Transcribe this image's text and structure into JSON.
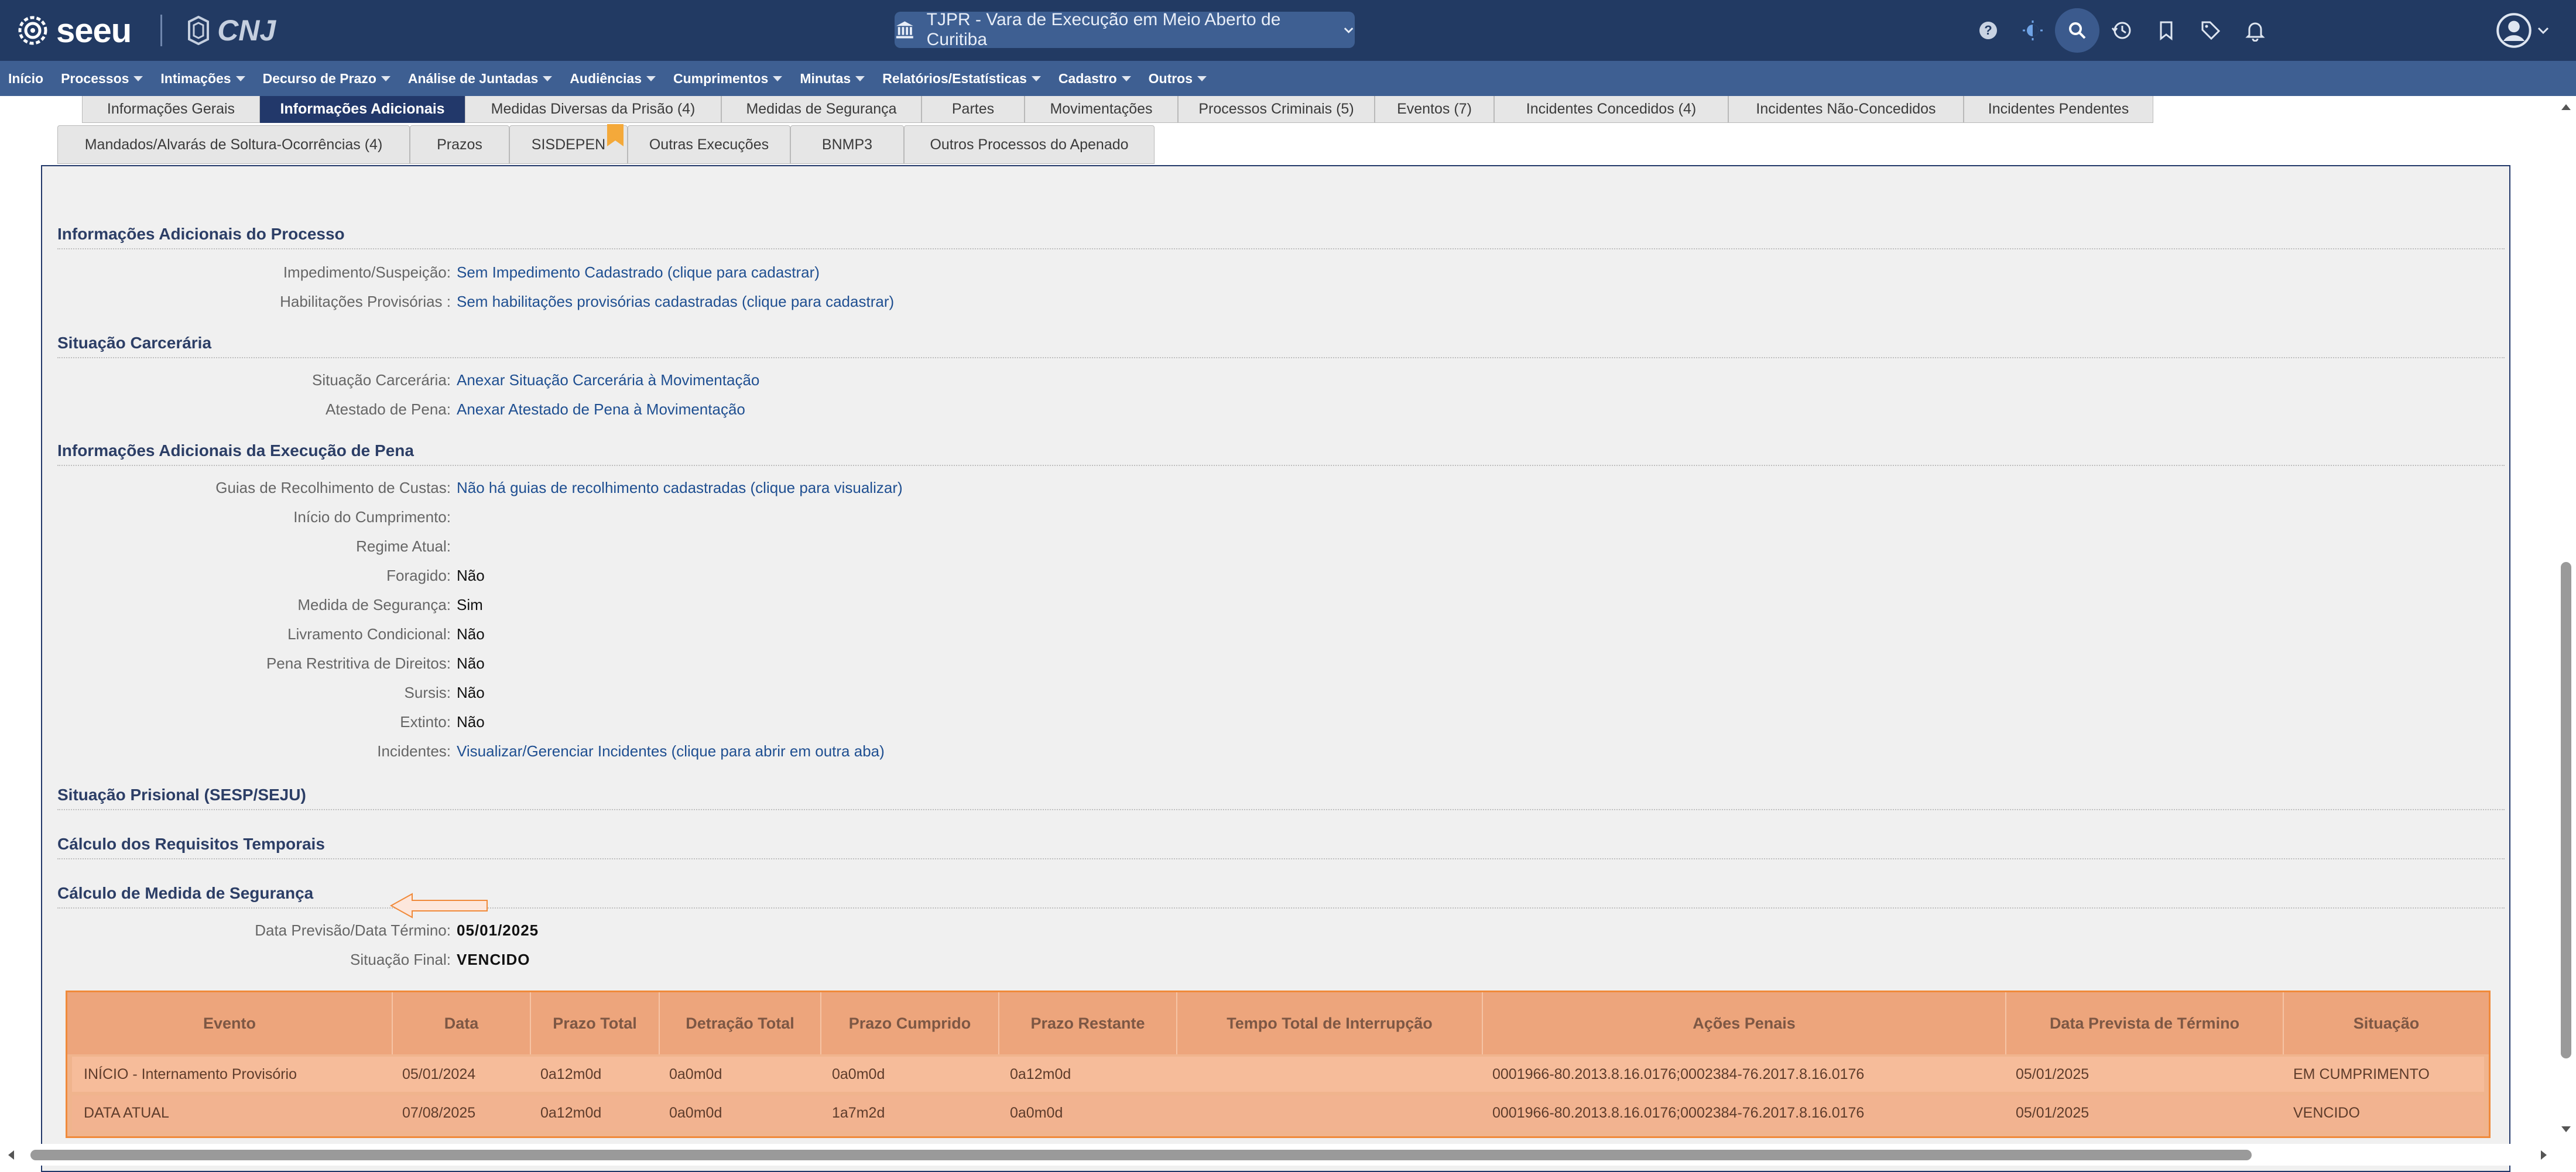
{
  "header": {
    "brand": "seeu",
    "partner": "CNJ",
    "court_selector": "TJPR - Vara de Execução em Meio Aberto de Curitiba",
    "icons": [
      "help-icon",
      "theme-icon",
      "search-icon",
      "history-icon",
      "bookmark-icon",
      "tag-icon",
      "bell-icon",
      "user-icon",
      "chevron-down-icon"
    ]
  },
  "menu": [
    {
      "label": "Início",
      "dropdown": false
    },
    {
      "label": "Processos",
      "dropdown": true
    },
    {
      "label": "Intimações",
      "dropdown": true
    },
    {
      "label": "Decurso de Prazo",
      "dropdown": true
    },
    {
      "label": "Análise de Juntadas",
      "dropdown": true
    },
    {
      "label": "Audiências",
      "dropdown": true
    },
    {
      "label": "Cumprimentos",
      "dropdown": true
    },
    {
      "label": "Minutas",
      "dropdown": true
    },
    {
      "label": "Relatórios/Estatísticas",
      "dropdown": true
    },
    {
      "label": "Cadastro",
      "dropdown": true
    },
    {
      "label": "Outros",
      "dropdown": true
    }
  ],
  "tabs_row1": [
    "Informações Gerais",
    "Informações Adicionais",
    "Medidas Diversas da Prisão (4)",
    "Medidas de Segurança",
    "Partes",
    "Movimentações",
    "Processos Criminais (5)",
    "Eventos (7)",
    "Incidentes Concedidos (4)",
    "Incidentes Não-Concedidos",
    "Incidentes Pendentes"
  ],
  "active_tab": "Informações Adicionais",
  "tabs_row2": [
    "Mandados/Alvarás de Soltura-Ocorrências (4)",
    "Prazos",
    "SISDEPEN",
    "Outras Execuções",
    "BNMP3",
    "Outros Processos do Apenado"
  ],
  "sections": {
    "processo": {
      "title": "Informações Adicionais do Processo",
      "rows": [
        {
          "label": "Impedimento/Suspeição:",
          "value": "Sem Impedimento Cadastrado (clique para cadastrar)"
        },
        {
          "label": "Habilitações Provisórias :",
          "value": "Sem habilitações provisórias cadastradas (clique para cadastrar)"
        }
      ]
    },
    "carceraria": {
      "title": "Situação Carcerária",
      "rows": [
        {
          "label": "Situação Carcerária:",
          "value": "Anexar Situação Carcerária à Movimentação"
        },
        {
          "label": "Atestado de Pena:",
          "value": "Anexar Atestado de Pena à Movimentação"
        }
      ]
    },
    "execucao": {
      "title": "Informações Adicionais da Execução de Pena",
      "rows": [
        {
          "label": "Guias de Recolhimento de Custas:",
          "value": "Não há guias de recolhimento cadastradas (clique para visualizar)"
        },
        {
          "label": "Início do Cumprimento:",
          "value": ""
        },
        {
          "label": "Regime Atual:",
          "value": ""
        },
        {
          "label": "Foragido:",
          "value": "Não"
        },
        {
          "label": "Medida de Segurança:",
          "value": "Sim"
        },
        {
          "label": "Livramento Condicional:",
          "value": "Não"
        },
        {
          "label": "Pena Restritiva de Direitos:",
          "value": "Não"
        },
        {
          "label": "Sursis:",
          "value": "Não"
        },
        {
          "label": "Extinto:",
          "value": "Não"
        },
        {
          "label": "Incidentes:",
          "value": "Visualizar/Gerenciar Incidentes (clique para abrir em outra aba)"
        }
      ]
    },
    "prisional": {
      "title": "Situação Prisional (SESP/SEJU)"
    },
    "temporais": {
      "title": "Cálculo dos Requisitos Temporais"
    },
    "medida": {
      "title": "Cálculo de Medida de Segurança",
      "rows": [
        {
          "label": "Data Previsão/Data Término:",
          "value": "05/01/2025"
        },
        {
          "label": "Situação Final:",
          "value": "VENCIDO"
        }
      ]
    }
  },
  "table": {
    "headers": [
      "Evento",
      "Data",
      "Prazo Total",
      "Detração Total",
      "Prazo Cumprido",
      "Prazo Restante",
      "Tempo Total de Interrupção",
      "Ações Penais",
      "Data Prevista de Término",
      "Situação"
    ],
    "rows": [
      [
        "INÍCIO - Internamento Provisório",
        "05/01/2024",
        "0a12m0d",
        "0a0m0d",
        "0a0m0d",
        "0a12m0d",
        "",
        "0001966-80.2013.8.16.0176;0002384-76.2017.8.16.0176",
        "05/01/2025",
        "EM CUMPRIMENTO"
      ],
      [
        "DATA ATUAL",
        "07/08/2025",
        "0a12m0d",
        "0a0m0d",
        "1a7m2d",
        "0a0m0d",
        "",
        "0001966-80.2013.8.16.0176;0002384-76.2017.8.16.0176",
        "05/01/2025",
        "VENCIDO"
      ]
    ]
  },
  "colors": {
    "header_bg": "#223a63",
    "menu_bg": "#3e5f92",
    "active_tab_bg": "#22386a",
    "link": "#1f4f91",
    "table_highlight": "#f08a3a"
  }
}
